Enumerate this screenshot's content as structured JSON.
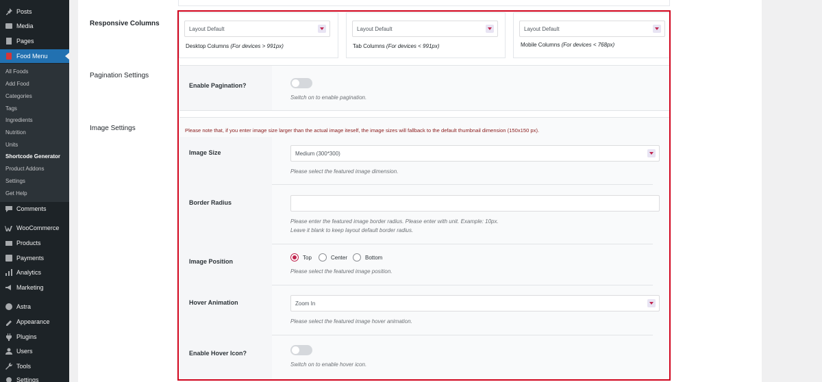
{
  "sidebar": {
    "top_items": [
      {
        "label": "Posts",
        "icon": "pin-icon"
      },
      {
        "label": "Media",
        "icon": "media-icon"
      },
      {
        "label": "Pages",
        "icon": "pages-icon"
      },
      {
        "label": "Food Menu",
        "icon": "food-menu-icon"
      }
    ],
    "submenu": [
      "All Foods",
      "Add Food",
      "Categories",
      "Tags",
      "Ingredients",
      "Nutrition",
      "Units",
      "Shortcode Generator",
      "Product Addons",
      "Settings",
      "Get Help"
    ],
    "bottom_items": [
      {
        "label": "Comments",
        "icon": "comments-icon"
      },
      {
        "label": "WooCommerce",
        "icon": "woocommerce-icon"
      },
      {
        "label": "Products",
        "icon": "products-icon"
      },
      {
        "label": "Payments",
        "icon": "payments-icon"
      },
      {
        "label": "Analytics",
        "icon": "analytics-icon"
      },
      {
        "label": "Marketing",
        "icon": "marketing-icon"
      },
      {
        "label": "Astra",
        "icon": "astra-icon"
      },
      {
        "label": "Appearance",
        "icon": "appearance-icon"
      },
      {
        "label": "Plugins",
        "icon": "plugins-icon"
      },
      {
        "label": "Users",
        "icon": "users-icon"
      },
      {
        "label": "Tools",
        "icon": "tools-icon"
      },
      {
        "label": "Settings",
        "icon": "settings-icon"
      }
    ]
  },
  "sections": {
    "responsive_columns": "Responsive Columns",
    "pagination_settings": "Pagination Settings",
    "image_settings": "Image Settings"
  },
  "columns": {
    "desktop": {
      "value": "Layout Default",
      "caption": "Desktop Columns",
      "note": "(For devices > 991px)"
    },
    "tab": {
      "value": "Layout Default",
      "caption": "Tab Columns",
      "note": "(For devices < 991px)"
    },
    "mobile": {
      "value": "Layout Default",
      "caption": "Mobile Columns",
      "note": "(For devices < 768px)"
    }
  },
  "pagination": {
    "label": "Enable Pagination?",
    "help": "Switch on to enable pagination.",
    "enabled": false
  },
  "image": {
    "notice": "Please note that, if you enter image size larger than the actual image iteself, the image sizes will fallback to the default thumbnail dimension (150x150 px).",
    "size_label": "Image Size",
    "size_value": "Medium (300*300)",
    "size_help": "Please select the featured image dimension.",
    "radius_label": "Border Radius",
    "radius_value": "",
    "radius_help_1": "Please enter the featured image border radius. Please enter with unit. Example: 10px.",
    "radius_help_2": "Leave it blank to keep layout default border radius.",
    "position_label": "Image Position",
    "position_options": [
      "Top",
      "Center",
      "Bottom"
    ],
    "position_selected": "Top",
    "position_help": "Please select the featured image position.",
    "hover_label": "Hover Animation",
    "hover_value": "Zoom In",
    "hover_help": "Please select the featured image hover animation.",
    "hover_icon_label": "Enable Hover Icon?",
    "hover_icon_help": "Switch on to enable hover icon.",
    "hover_icon_enabled": false
  },
  "colors": {
    "accent": "#c0254e",
    "outline": "#d0021b",
    "admin_bar": "#1d2327",
    "active_menu": "#2271b1"
  }
}
